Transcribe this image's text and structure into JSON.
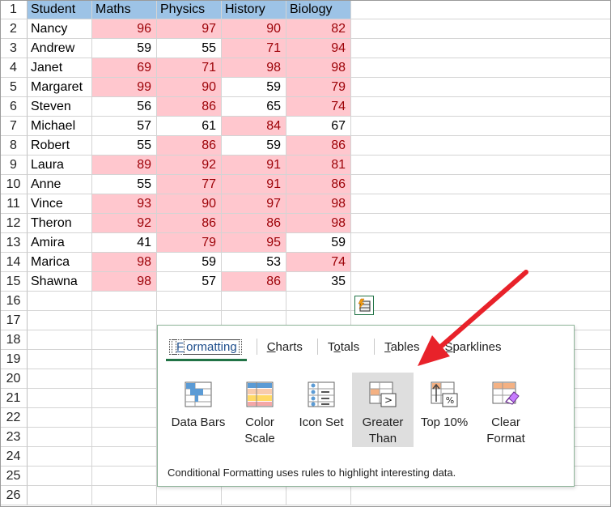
{
  "headers": [
    "Student",
    "Maths",
    "Physics",
    "History",
    "Biology"
  ],
  "rows": [
    {
      "num": "2",
      "name": "Nancy",
      "vals": [
        "96",
        "97",
        "90",
        "82"
      ],
      "hl": [
        1,
        1,
        1,
        1
      ]
    },
    {
      "num": "3",
      "name": "Andrew",
      "vals": [
        "59",
        "55",
        "71",
        "94"
      ],
      "hl": [
        0,
        0,
        1,
        1
      ]
    },
    {
      "num": "4",
      "name": "Janet",
      "vals": [
        "69",
        "71",
        "98",
        "98"
      ],
      "hl": [
        1,
        1,
        1,
        1
      ]
    },
    {
      "num": "5",
      "name": "Margaret",
      "vals": [
        "99",
        "90",
        "59",
        "79"
      ],
      "hl": [
        1,
        1,
        0,
        1
      ]
    },
    {
      "num": "6",
      "name": "Steven",
      "vals": [
        "56",
        "86",
        "65",
        "74"
      ],
      "hl": [
        0,
        1,
        0,
        1
      ]
    },
    {
      "num": "7",
      "name": "Michael",
      "vals": [
        "57",
        "61",
        "84",
        "67"
      ],
      "hl": [
        0,
        0,
        1,
        0
      ]
    },
    {
      "num": "8",
      "name": "Robert",
      "vals": [
        "55",
        "86",
        "59",
        "86"
      ],
      "hl": [
        0,
        1,
        0,
        1
      ]
    },
    {
      "num": "9",
      "name": "Laura",
      "vals": [
        "89",
        "92",
        "91",
        "81"
      ],
      "hl": [
        1,
        1,
        1,
        1
      ]
    },
    {
      "num": "10",
      "name": "Anne",
      "vals": [
        "55",
        "77",
        "91",
        "86"
      ],
      "hl": [
        0,
        1,
        1,
        1
      ]
    },
    {
      "num": "11",
      "name": "Vince",
      "vals": [
        "93",
        "90",
        "97",
        "98"
      ],
      "hl": [
        1,
        1,
        1,
        1
      ]
    },
    {
      "num": "12",
      "name": "Theron",
      "vals": [
        "92",
        "86",
        "86",
        "98"
      ],
      "hl": [
        1,
        1,
        1,
        1
      ]
    },
    {
      "num": "13",
      "name": "Amira",
      "vals": [
        "41",
        "79",
        "95",
        "59"
      ],
      "hl": [
        0,
        1,
        1,
        0
      ]
    },
    {
      "num": "14",
      "name": "Marica",
      "vals": [
        "98",
        "59",
        "53",
        "74"
      ],
      "hl": [
        1,
        0,
        0,
        1
      ]
    },
    {
      "num": "15",
      "name": "Shawna",
      "vals": [
        "98",
        "57",
        "86",
        "35"
      ],
      "hl": [
        1,
        0,
        1,
        0
      ]
    }
  ],
  "empty_rows": [
    "16",
    "17",
    "18",
    "19",
    "20",
    "21",
    "22",
    "23",
    "24",
    "25",
    "26"
  ],
  "header_row_num": "1",
  "colors": {
    "highlight_fill": "#ffc7ce",
    "highlight_text": "#9c0006",
    "header_fill": "#9dc3e6",
    "accent": "#217346",
    "arrow": "#e8222a"
  },
  "quick_analysis": {
    "icon": "quick-analysis-icon",
    "tabs": {
      "formatting": {
        "pre": "",
        "u": "F",
        "post": "ormatting"
      },
      "charts": {
        "pre": "",
        "u": "C",
        "post": "harts"
      },
      "totals": {
        "pre": "T",
        "u": "o",
        "post": "tals"
      },
      "tables": {
        "pre": "",
        "u": "T",
        "post": "ables"
      },
      "sparklines": {
        "pre": "",
        "u": "S",
        "post": "parklines"
      }
    },
    "tools": {
      "data_bars": {
        "l1": "Data Bars",
        "l2": "",
        "icon": "data-bars-icon"
      },
      "color_scale": {
        "l1": "Color",
        "l2": "Scale",
        "icon": "color-scale-icon"
      },
      "icon_set": {
        "l1": "Icon Set",
        "l2": "",
        "icon": "icon-set-icon"
      },
      "greater_than": {
        "l1": "Greater",
        "l2": "Than",
        "icon": "greater-than-icon"
      },
      "top10": {
        "l1": "Top 10%",
        "l2": "",
        "icon": "top-10-percent-icon"
      },
      "clear_format": {
        "l1": "Clear",
        "l2": "Format",
        "icon": "clear-format-icon"
      }
    },
    "description": "Conditional Formatting uses rules to highlight interesting data."
  }
}
